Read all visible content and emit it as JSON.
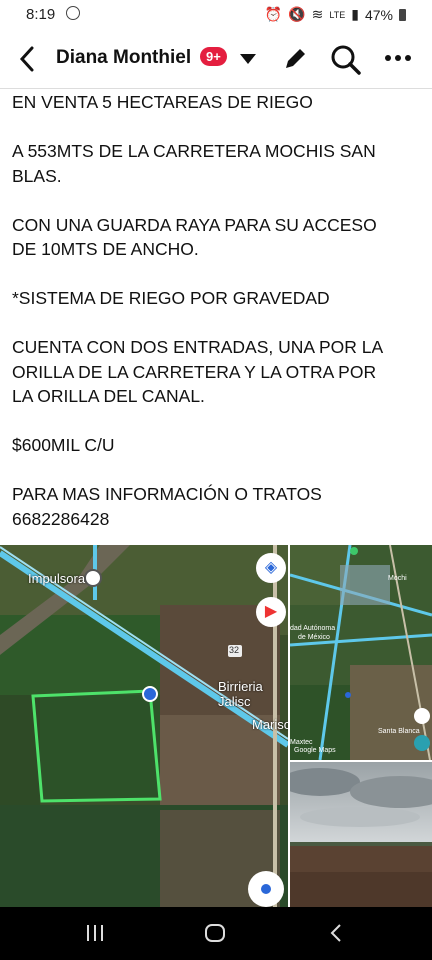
{
  "status": {
    "time": "8:19",
    "battery": "47%",
    "signal": "LTE"
  },
  "header": {
    "profile_name": "Diana Monthiel",
    "notification_badge": "9+"
  },
  "post": {
    "lines": [
      "EN VENTA 5 HECTAREAS DE RIEGO",
      "",
      "A 553MTS DE LA CARRETERA MOCHIS SAN",
      "BLAS.",
      "",
      "CON UNA GUARDA RAYA PARA SU ACCESO",
      "DE 10MTS DE ANCHO.",
      "",
      "*SISTEMA DE RIEGO POR GRAVEDAD",
      "",
      "CUENTA CON DOS ENTRADAS, UNA POR LA",
      "ORILLA DE LA CARRETERA  Y LA OTRA POR",
      "LA ORILLA DEL CANAL.",
      "",
      "$600MIL C/U",
      "",
      "PARA MAS INFORMACIÓN O TRATOS",
      "6682286428"
    ]
  },
  "map_main": {
    "label_impulsora": "Impulsora",
    "label_road": "32",
    "label_birrieria": "Birrieria Jalisc",
    "label_mariscos": "Mariso"
  },
  "map_small": {
    "label_1": "dad Autónoma",
    "label_2": "de México",
    "label_3": "Santa Blanca",
    "label_4": "Google Maps",
    "label_5": "Maxtec",
    "label_6": "Mochi"
  },
  "icons": [
    "back-arrow-icon",
    "dropdown-caret-icon",
    "edit-pencil-icon",
    "search-icon",
    "more-options-icon",
    "layers-icon",
    "compass-icon",
    "location-icon",
    "recent-apps-icon",
    "home-icon",
    "back-nav-icon"
  ],
  "colors": {
    "badge": "#e41e3f",
    "field_outline": "#4ee26a",
    "road": "#5ec8ea"
  }
}
